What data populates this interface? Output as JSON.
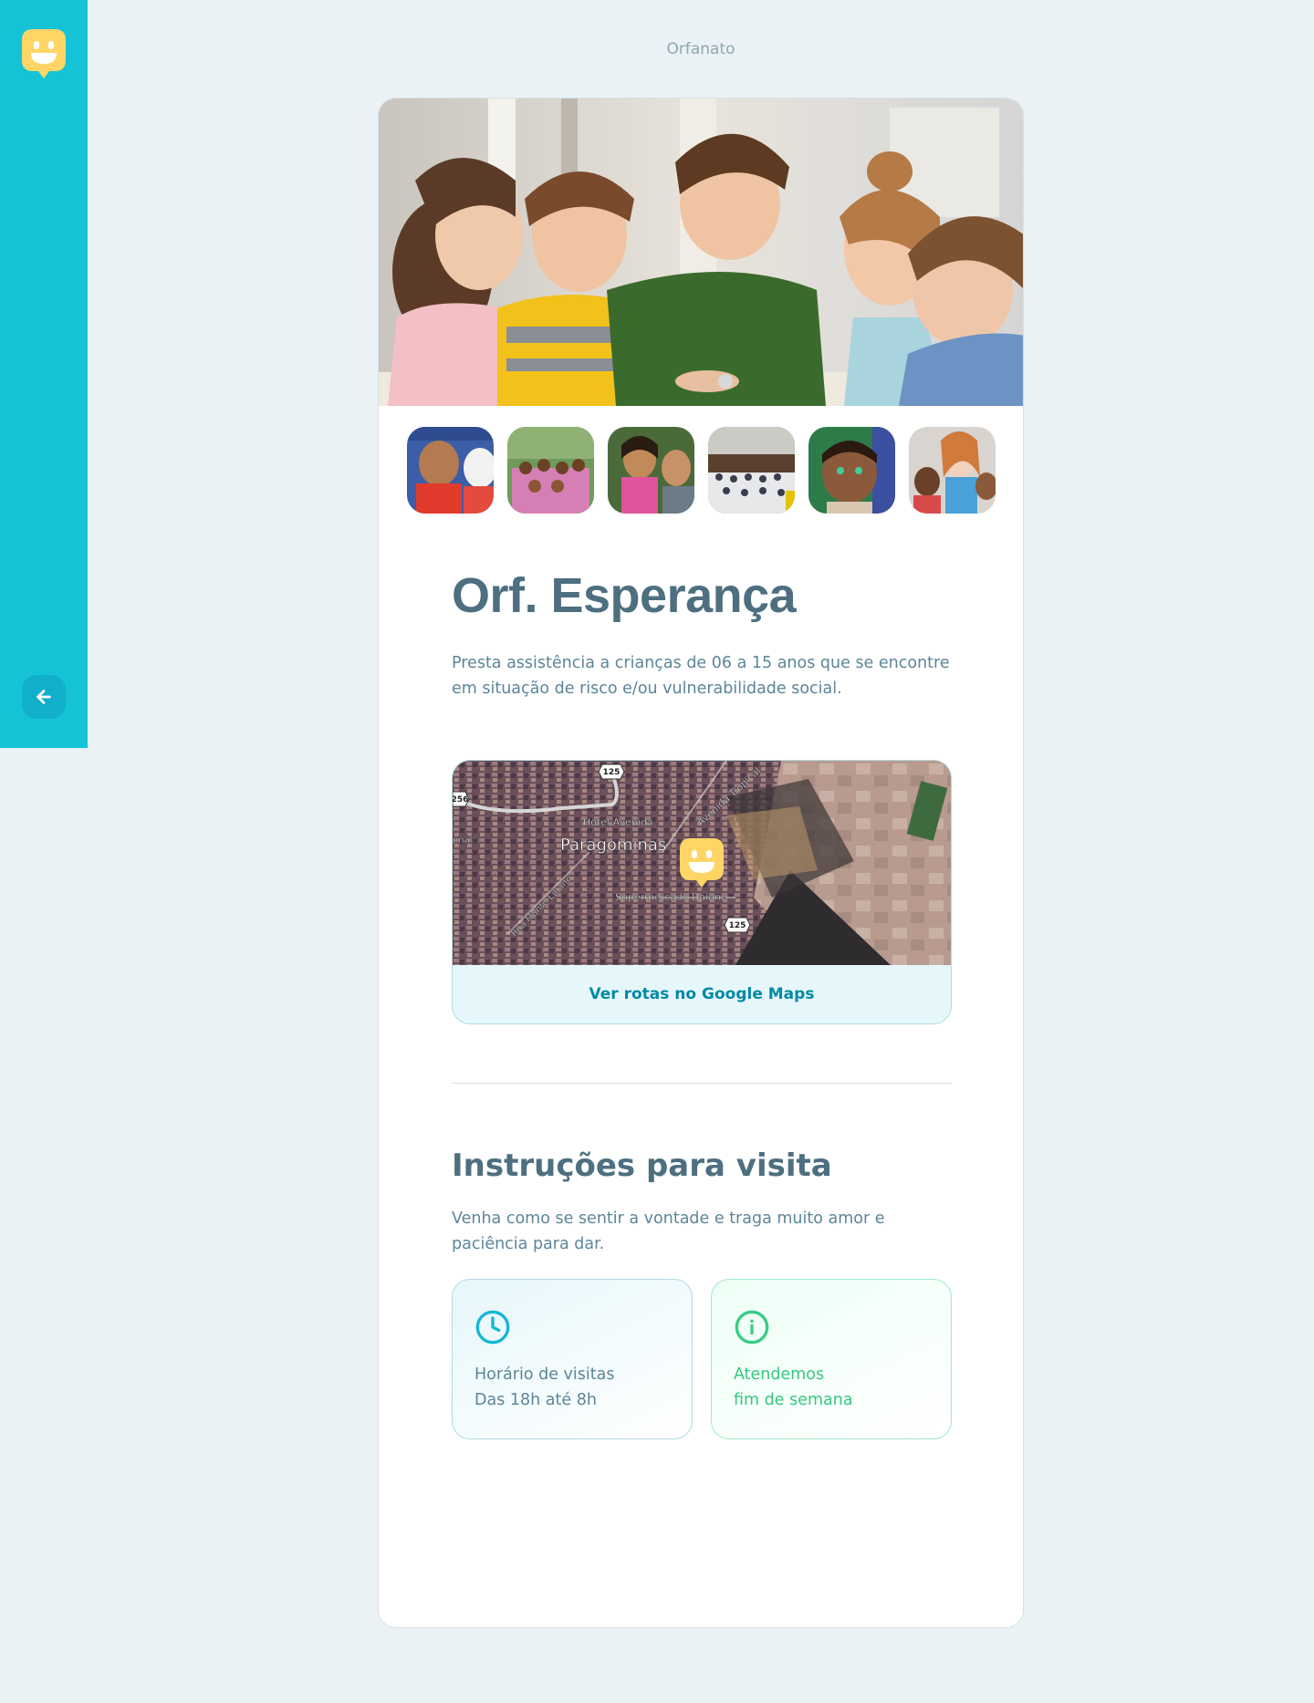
{
  "header": {
    "page_label": "Orfanato"
  },
  "orphanage": {
    "name": "Orf. Esperança",
    "about": "Presta assistência a crianças de 06 a 15 anos que se encontre em situação de risco e/ou vulnerabilidade social."
  },
  "map": {
    "link_label": "Ver rotas no Google Maps",
    "labels": {
      "city": "Paragominas",
      "hotel": "Hotel Avenida",
      "avenue": "Avenida Tropical",
      "market": "Supermercado Daiane",
      "street": "Rua Monte Líbano",
      "road1": "125",
      "road2": "125",
      "road3": "256",
      "edge": "onál"
    }
  },
  "visit": {
    "title": "Instruções para visita",
    "instructions": "Venha como se sentir a vontade e traga muito amor e paciência para dar.",
    "hours_line1": "Horário de visitas",
    "hours_line2": "Das 18h até 8h",
    "weekend_line1": "Atendemos",
    "weekend_line2": "fim de semana"
  },
  "colors": {
    "sidebar": "#15c3d6",
    "logo": "#ffd666",
    "title": "#4d6f80",
    "text": "#5c8599",
    "link": "#0089a5",
    "green": "#37c77f"
  },
  "icons": {
    "logo": "smiley-logo-icon",
    "back": "arrow-left-icon",
    "hours": "clock-icon",
    "weekend": "info-icon",
    "map_marker": "smiley-marker-icon"
  }
}
